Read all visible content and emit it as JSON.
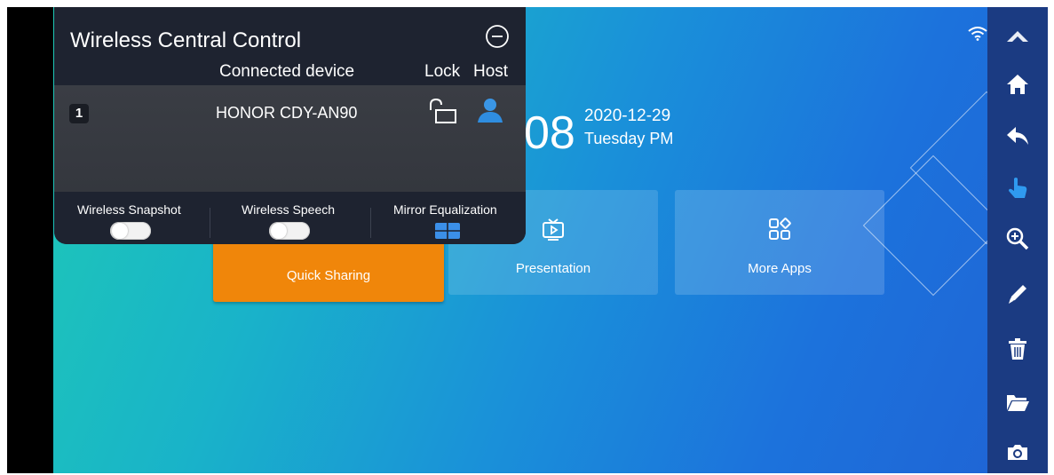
{
  "panel": {
    "title": "Wireless Central Control",
    "columns": {
      "connected_device": "Connected device",
      "lock": "Lock",
      "host": "Host"
    },
    "devices": [
      {
        "index": "1",
        "name": "HONOR CDY-AN90",
        "lock_state": "unlocked",
        "host": true
      }
    ],
    "options": {
      "wireless_snapshot": {
        "label": "Wireless Snapshot",
        "enabled": false
      },
      "wireless_speech": {
        "label": "Wireless Speech",
        "enabled": false
      },
      "mirror_equalization": {
        "label": "Mirror Equalization"
      }
    }
  },
  "clock": {
    "time_fragment": "08",
    "date": "2020-12-29",
    "day": "Tuesday  PM"
  },
  "tiles": {
    "quick_sharing": "Quick Sharing",
    "presentation": "Presentation",
    "more_apps": "More Apps"
  },
  "toolbar": {
    "icons": [
      "collapse-icon",
      "home-icon",
      "back-icon",
      "touch-icon",
      "zoom-in-icon",
      "pen-icon",
      "trash-icon",
      "folder-icon",
      "camera-icon"
    ]
  },
  "colors": {
    "accent_orange": "#f0860a",
    "panel_bg": "#1e2330",
    "toolbar_bg": "#1b3b82",
    "host_blue": "#2f8de0"
  }
}
